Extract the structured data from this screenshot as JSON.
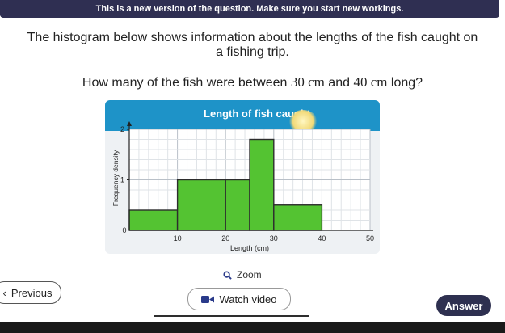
{
  "banner": "This is a new version of the question. Make sure you start new workings.",
  "question": {
    "line1": "The histogram below shows information about the lengths of the fish caught on",
    "line2": "a fishing trip.",
    "ask_prefix": "How many of the fish were between ",
    "ask_math1": "30 cm",
    "ask_mid": " and ",
    "ask_math2": "40 cm",
    "ask_suffix": " long?"
  },
  "colors": {
    "header": "#1e93c8",
    "bar": "#54c332",
    "bar_edge": "#2d2d2d",
    "answer_button": "#2e3050",
    "banner": "#2f2f52"
  },
  "chart_data": {
    "type": "bar",
    "title": "Length of fish caught",
    "xlabel": "Length (cm)",
    "ylabel": "Frequency density",
    "xlim": [
      0,
      50
    ],
    "ylim": [
      0,
      2
    ],
    "xticks": [
      0,
      10,
      20,
      30,
      40,
      50
    ],
    "yticks": [
      1,
      2
    ],
    "grid": true,
    "bins": [
      {
        "x0": 0,
        "x1": 10,
        "density": 0.4
      },
      {
        "x0": 10,
        "x1": 20,
        "density": 1.0
      },
      {
        "x0": 20,
        "x1": 25,
        "density": 1.0
      },
      {
        "x0": 25,
        "x1": 30,
        "density": 1.8
      },
      {
        "x0": 30,
        "x1": 40,
        "density": 0.5
      }
    ]
  },
  "controls": {
    "zoom": "Zoom",
    "previous": "Previous",
    "watch_video": "Watch video",
    "answer": "Answer"
  },
  "icons": {
    "zoom": "magnifier-icon",
    "previous": "chevron-left-icon",
    "video": "video-camera-icon"
  }
}
